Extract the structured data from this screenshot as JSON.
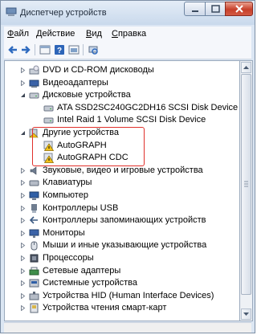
{
  "window": {
    "title": "Диспетчер устройств"
  },
  "menu": [
    {
      "label": "Файл",
      "hotkey": "Ф",
      "rest": "айл"
    },
    {
      "label": "Действие",
      "hotkey": "Д",
      "rest": "ействие"
    },
    {
      "label": "Вид",
      "hotkey": "В",
      "rest": "ид"
    },
    {
      "label": "Справка",
      "hotkey": "С",
      "rest": "правка"
    }
  ],
  "toolbar": {
    "icons": [
      "back-arrow-icon",
      "forward-arrow-icon",
      "properties-icon",
      "help-icon",
      "update-driver-icon",
      "scan-hardware-icon"
    ]
  },
  "tree": {
    "items": [
      {
        "label": "DVD и CD-ROM дисководы",
        "level": 1,
        "expander": "collapsed",
        "icon": "cdrom-icon"
      },
      {
        "label": "Видеоадаптеры",
        "level": 1,
        "expander": "collapsed",
        "icon": "display-adapter-icon"
      },
      {
        "label": "Дисковые устройства",
        "level": 1,
        "expander": "expanded",
        "icon": "disk-drive-icon"
      },
      {
        "label": "ATA SSD2SC240GC2DH16 SCSI Disk Device",
        "level": 2,
        "expander": "none",
        "icon": "disk-drive-icon"
      },
      {
        "label": "Intel Raid 1 Volume SCSI Disk Device",
        "level": 2,
        "expander": "none",
        "icon": "disk-drive-icon"
      },
      {
        "label": "Другие устройства",
        "level": 1,
        "expander": "expanded",
        "icon": "unknown-device-icon"
      },
      {
        "label": "AutoGRAPH",
        "level": 2,
        "expander": "none",
        "icon": "warning-device-icon"
      },
      {
        "label": "AutoGRAPH CDC",
        "level": 2,
        "expander": "none",
        "icon": "warning-device-icon"
      },
      {
        "label": "Звуковые, видео и игровые устройства",
        "level": 1,
        "expander": "collapsed",
        "icon": "sound-icon"
      },
      {
        "label": "Клавиатуры",
        "level": 1,
        "expander": "collapsed",
        "icon": "keyboard-icon"
      },
      {
        "label": "Компьютер",
        "level": 1,
        "expander": "collapsed",
        "icon": "computer-icon"
      },
      {
        "label": "Контроллеры USB",
        "level": 1,
        "expander": "collapsed",
        "icon": "usb-icon"
      },
      {
        "label": "Контроллеры запоминающих устройств",
        "level": 1,
        "expander": "collapsed",
        "icon": "storage-controller-icon"
      },
      {
        "label": "Мониторы",
        "level": 1,
        "expander": "collapsed",
        "icon": "monitor-icon"
      },
      {
        "label": "Мыши и иные указывающие устройства",
        "level": 1,
        "expander": "collapsed",
        "icon": "mouse-icon"
      },
      {
        "label": "Процессоры",
        "level": 1,
        "expander": "collapsed",
        "icon": "processor-icon"
      },
      {
        "label": "Сетевые адаптеры",
        "level": 1,
        "expander": "collapsed",
        "icon": "network-adapter-icon"
      },
      {
        "label": "Системные устройства",
        "level": 1,
        "expander": "collapsed",
        "icon": "system-device-icon"
      },
      {
        "label": "Устройства HID (Human Interface Devices)",
        "level": 1,
        "expander": "collapsed",
        "icon": "hid-icon"
      },
      {
        "label": "Устройства чтения смарт-карт",
        "level": 1,
        "expander": "collapsed",
        "icon": "smartcard-reader-icon"
      }
    ]
  },
  "colors": {
    "highlight_border": "#e0302b",
    "warning": "#f2c21b"
  }
}
